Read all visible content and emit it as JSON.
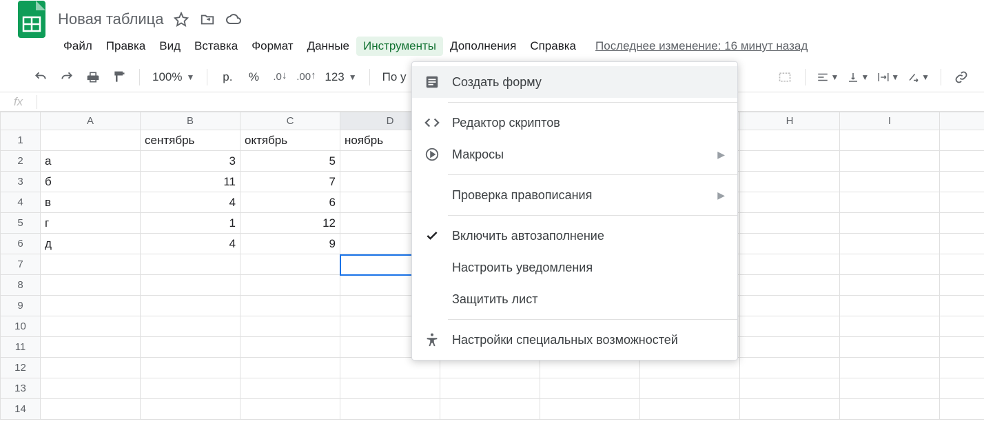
{
  "header": {
    "title": "Новая таблица"
  },
  "menubar": {
    "items": [
      {
        "label": "Файл"
      },
      {
        "label": "Правка"
      },
      {
        "label": "Вид"
      },
      {
        "label": "Вставка"
      },
      {
        "label": "Формат"
      },
      {
        "label": "Данные"
      },
      {
        "label": "Инструменты"
      },
      {
        "label": "Дополнения"
      },
      {
        "label": "Справка"
      }
    ],
    "active_index": 6,
    "last_change": "Последнее изменение: 16 минут назад"
  },
  "toolbar": {
    "zoom": "100%",
    "currency": "р.",
    "percent": "%",
    "dec_less": ".0",
    "dec_more": ".00",
    "num_format": "123",
    "font_truncated": "По у"
  },
  "formula_bar": {
    "fx": "fx",
    "value": ""
  },
  "grid": {
    "column_headers": [
      "A",
      "B",
      "C",
      "D",
      "",
      "",
      "",
      "H",
      "I",
      ""
    ],
    "row_headers": [
      "1",
      "2",
      "3",
      "4",
      "5",
      "6",
      "7",
      "8",
      "9",
      "10",
      "11",
      "12",
      "13",
      "14"
    ],
    "selected_col_index": 3,
    "cells": {
      "B1": "сентябрь",
      "C1": "октябрь",
      "D1": "ноябрь",
      "A2": "а",
      "B2": "3",
      "C2": "5",
      "A3": "б",
      "B3": "11",
      "C3": "7",
      "A4": "в",
      "B4": "4",
      "C4": "6",
      "A5": "г",
      "B5": "1",
      "C5": "12",
      "A6": "д",
      "B6": "4",
      "C6": "9"
    },
    "selected_cell": "D7"
  },
  "dropdown": {
    "items": [
      {
        "label": "Создать форму"
      },
      {
        "label": "Редактор скриптов"
      },
      {
        "label": "Макросы"
      },
      {
        "label": "Проверка правописания"
      },
      {
        "label": "Включить автозаполнение"
      },
      {
        "label": "Настроить уведомления"
      },
      {
        "label": "Защитить лист"
      },
      {
        "label": "Настройки специальных возможностей"
      }
    ]
  }
}
